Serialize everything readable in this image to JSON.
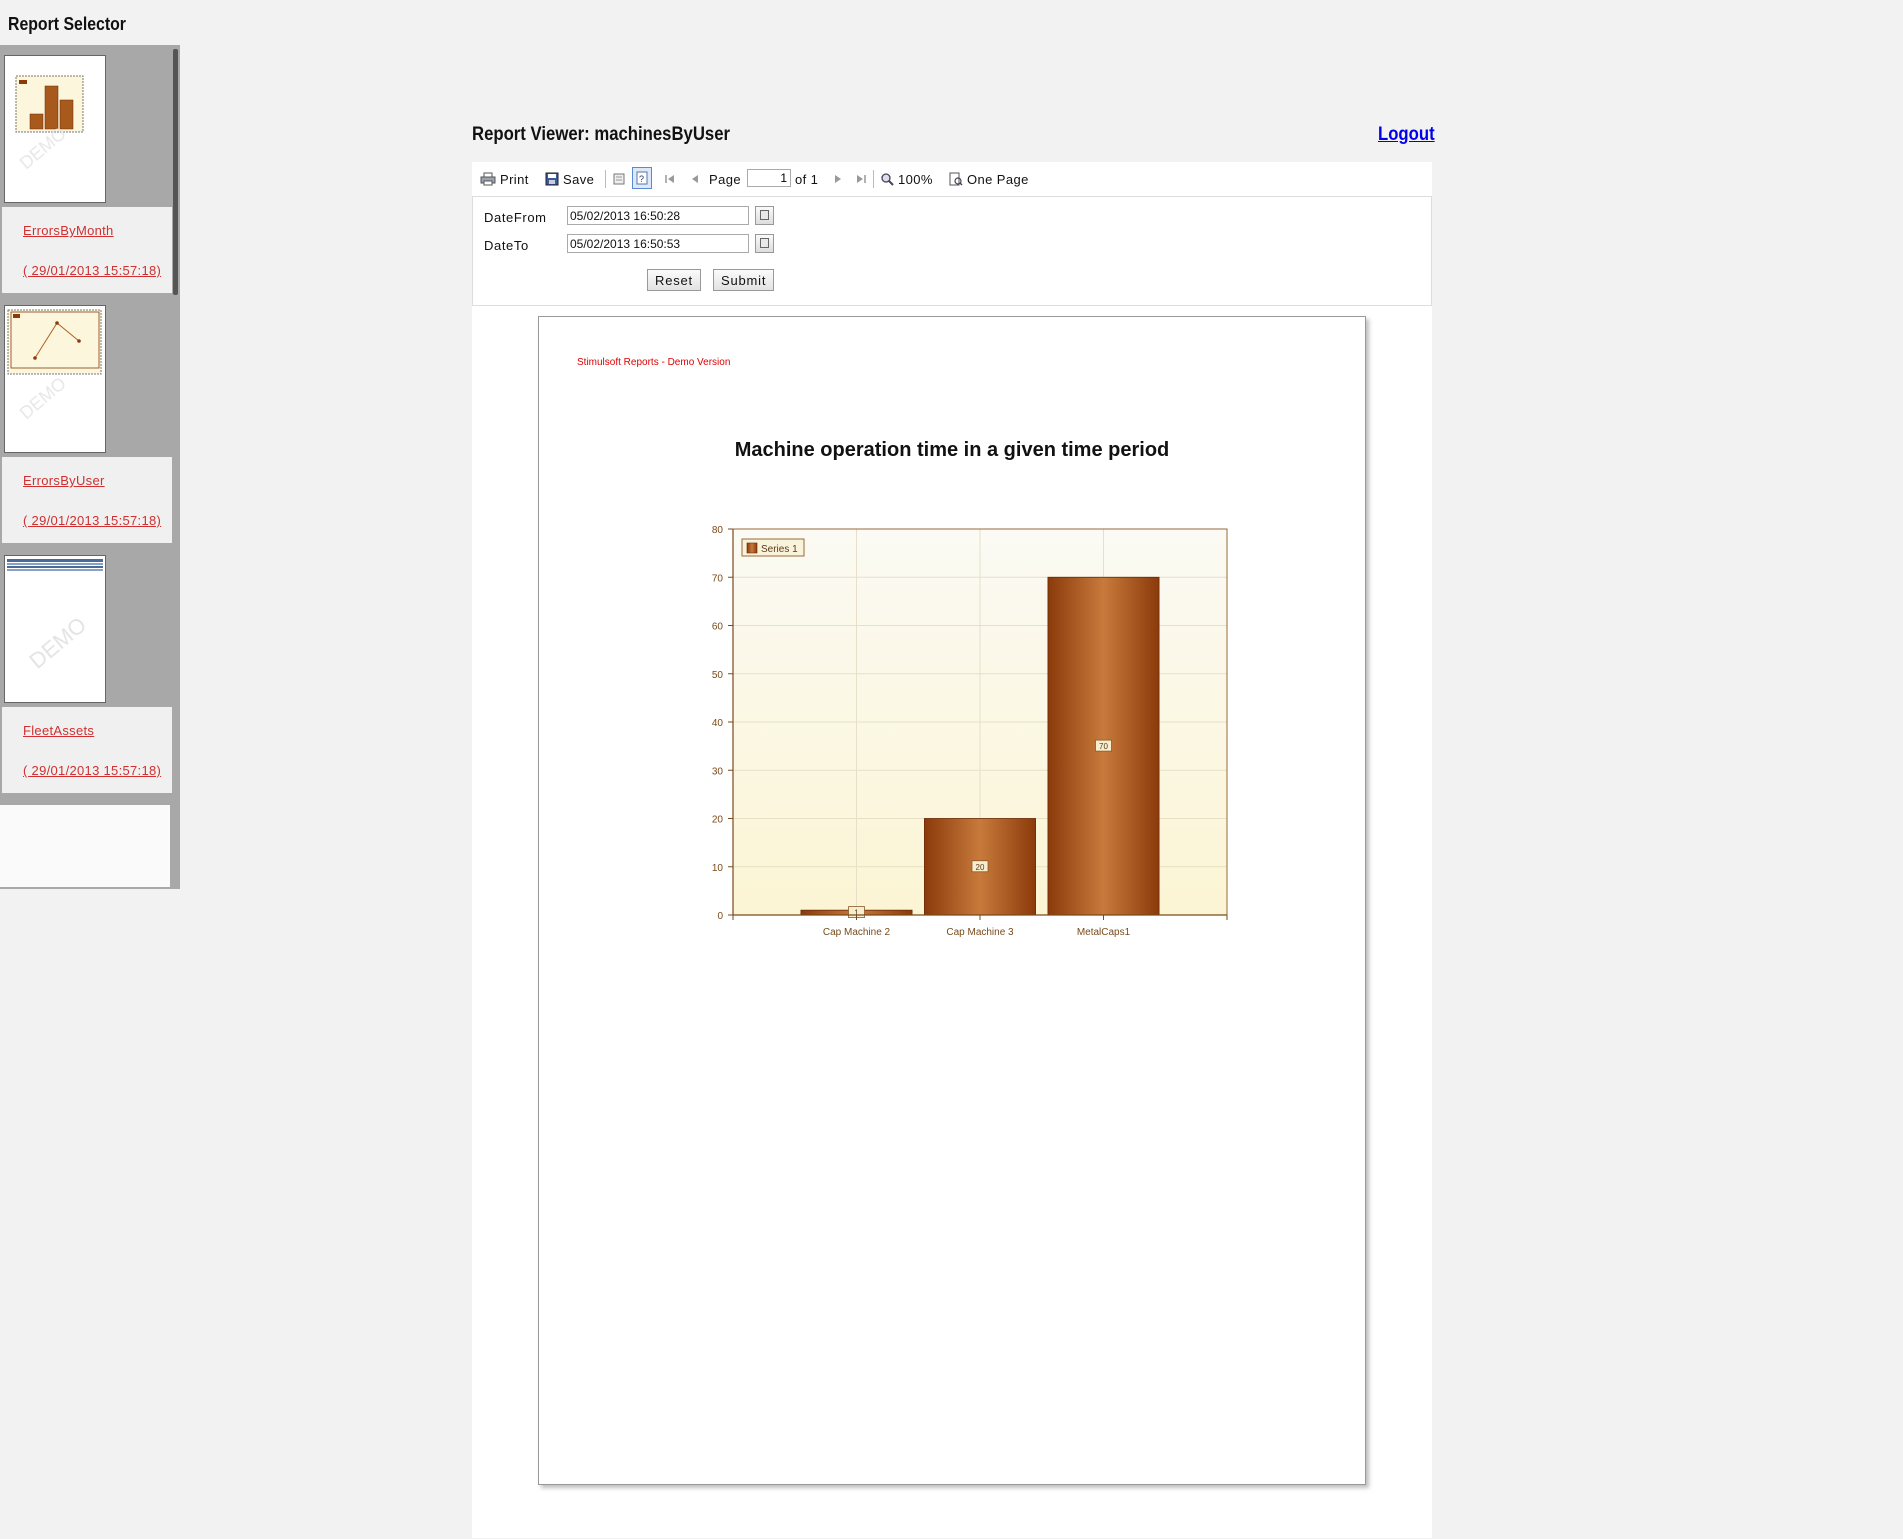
{
  "sidebar": {
    "title": "Report Selector",
    "items": [
      {
        "name": "ErrorsByMonth",
        "date": "( 29/01/2013 15:57:18)",
        "thumbnail": "bar-chart-thumbnail"
      },
      {
        "name": "ErrorsByUser",
        "date": "( 29/01/2013 15:57:18)",
        "thumbnail": "line-chart-thumbnail"
      },
      {
        "name": "FleetAssets",
        "date": "( 29/01/2013 15:57:18)",
        "thumbnail": "table-report-thumbnail"
      }
    ],
    "thumbnail_watermark": "DEMO"
  },
  "viewer": {
    "title": "Report Viewer: machinesByUser",
    "logout_label": "Logout",
    "toolbar": {
      "print_label": "Print",
      "save_label": "Save",
      "page_label": "Page",
      "page_value": "1",
      "of_label": "of 1",
      "zoom_label": "100%",
      "view_mode_label": "One Page"
    },
    "params": {
      "date_from_label": "DateFrom",
      "date_from_value": "05/02/2013 16:50:28",
      "date_to_label": "DateTo",
      "date_to_value": "05/02/2013 16:50:53",
      "reset_label": "Reset",
      "submit_label": "Submit"
    },
    "report": {
      "watermark": "Stimulsoft Reports - Demo Version",
      "chart_title": "Machine operation time in a given time period"
    }
  },
  "colors": {
    "bar_dark": "#8b3a0a",
    "bar_light": "#c87a3c",
    "plot_bg_top": "#fbfaf4",
    "plot_bg_bottom": "#fbf5d4",
    "axis_text": "#7a4a1a",
    "link_red": "#d03030"
  },
  "chart_data": {
    "type": "bar",
    "title": "Machine operation time in a given time period",
    "categories": [
      "Cap Machine 2",
      "Cap Machine 3",
      "MetalCaps1"
    ],
    "series": [
      {
        "name": "Series 1",
        "values": [
          1,
          20,
          70
        ]
      }
    ],
    "data_labels": [
      "1",
      "20",
      "70"
    ],
    "ylim": [
      0,
      80
    ],
    "yticks": [
      0,
      10,
      20,
      30,
      40,
      50,
      60,
      70,
      80
    ],
    "xlabel": "",
    "ylabel": "",
    "grid": true,
    "legend": "top-left"
  }
}
